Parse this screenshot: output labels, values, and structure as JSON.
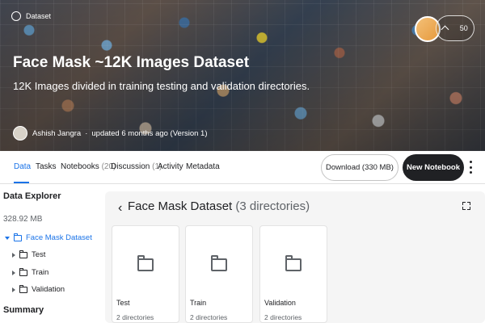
{
  "hero": {
    "badge_label": "Dataset",
    "title": "Face Mask ~12K Images Dataset",
    "subtitle": "12K Images divided in training testing and validation directories.",
    "author": "Ashish Jangra",
    "updated": "updated 6 months ago (Version 1)",
    "vote_count": "50",
    "accent_color": "#f0a95a"
  },
  "tabs": [
    {
      "label": "Data",
      "count": ""
    },
    {
      "label": "Tasks",
      "count": ""
    },
    {
      "label": "Notebooks",
      "count": "(20)"
    },
    {
      "label": "Discussion",
      "count": "(1)"
    },
    {
      "label": "Activity",
      "count": ""
    },
    {
      "label": "Metadata",
      "count": ""
    }
  ],
  "actions": {
    "download": "Download (330 MB)",
    "new_notebook": "New Notebook"
  },
  "explorer": {
    "title": "Data Explorer",
    "size": "328.92 MB",
    "root": "Face Mask Dataset",
    "children": [
      "Test",
      "Train",
      "Validation"
    ],
    "summary": "Summary"
  },
  "panel": {
    "back_icon": "‹",
    "title": "Face Mask Dataset",
    "dir_count": "(3 directories)",
    "cards": [
      {
        "name": "Test",
        "meta": "2 directories"
      },
      {
        "name": "Train",
        "meta": "2 directories"
      },
      {
        "name": "Validation",
        "meta": "2 directories"
      }
    ]
  }
}
